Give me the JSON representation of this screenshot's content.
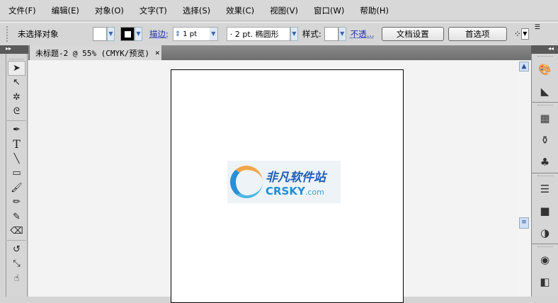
{
  "menu": [
    "文件(F)",
    "编辑(E)",
    "对象(O)",
    "文字(T)",
    "选择(S)",
    "效果(C)",
    "视图(V)",
    "窗口(W)",
    "帮助(H)"
  ],
  "control": {
    "selection": "未选择对象",
    "stroke_label": "描边:",
    "stroke_weight": "1 pt",
    "brush": "· 2 pt. 椭圆形",
    "style_label": "样式:",
    "opacity_link": "不透...",
    "doc_setup": "文档设置",
    "preferences": "首选项"
  },
  "document": {
    "tab_title": "未标题-2 @ 55% (CMYK/预览)",
    "close": "×"
  },
  "panel_toggles": {
    "left": "▸▸",
    "right": "◂◂"
  },
  "watermark": {
    "cn": "非凡软件站",
    "en": "CRSKY",
    "dot": ".com"
  }
}
